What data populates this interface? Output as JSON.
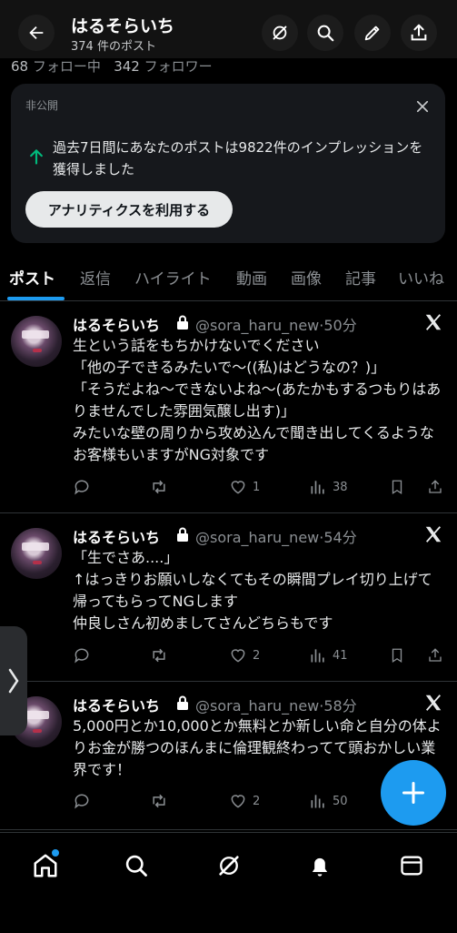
{
  "header": {
    "title": "はるそらいち",
    "subtitle": "374 件のポスト",
    "icons": [
      "back-arrow-icon",
      "grok-icon",
      "search-icon",
      "pencil-icon",
      "share-icon"
    ]
  },
  "profile": {
    "following_count": "68",
    "following_label": "フォロー中",
    "followers_count": "342",
    "followers_label": "フォロワー"
  },
  "analytics_card": {
    "private_label": "非公開",
    "message": "過去7日間にあなたのポストは9822件のインプレッションを獲得しました",
    "button_label": "アナリティクスを利用する",
    "accent_color": "#00ba7c"
  },
  "tabs": [
    {
      "label": "ポスト",
      "active": true
    },
    {
      "label": "返信"
    },
    {
      "label": "ハイライト"
    },
    {
      "label": "動画"
    },
    {
      "label": "画像"
    },
    {
      "label": "記事"
    },
    {
      "label": "いいね"
    }
  ],
  "posts": [
    {
      "name": "はるそらいち",
      "handle": "@sora_haru_new",
      "time": "50分",
      "body": "生という話をもちかけないでください\n「他の子できるみたいで〜((私)はどうなの？)」\n「そうだよね〜できないよね〜(あたかもするつもりはありませんでした雰囲気醸し出す)」\nみたいな壁の周りから攻め込んで聞き出してくるようなお客様もいますがNG対象です",
      "replies": "",
      "reposts": "",
      "likes": "1",
      "views": "38"
    },
    {
      "name": "はるそらいち",
      "handle": "@sora_haru_new",
      "time": "54分",
      "body": "「生でさあ....」\n↑はっきりお願いしなくてもその瞬間プレイ切り上げて帰ってもらってNGします\n仲良しさん初めましてさんどちらもです",
      "replies": "",
      "reposts": "",
      "likes": "2",
      "views": "41"
    },
    {
      "name": "はるそらいち",
      "handle": "@sora_haru_new",
      "time": "58分",
      "body": "5,000円とか10,000とか無料とか新しい命と自分の体よりお金が勝つのほんまに倫理観終わってて頭おかしい業界です！",
      "replies": "",
      "reposts": "",
      "likes": "2",
      "views": "50"
    }
  ],
  "bottom_nav": [
    "home-icon",
    "search-icon",
    "grok-icon",
    "notifications-icon",
    "messages-icon"
  ],
  "colors": {
    "accent": "#1d9bf0",
    "background": "#000000"
  }
}
